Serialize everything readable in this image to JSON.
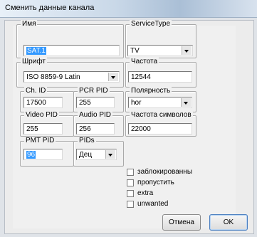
{
  "window": {
    "title": "Сменить данные канала"
  },
  "fields": {
    "name": {
      "label": "Имя",
      "value": "SAT.1"
    },
    "service_type": {
      "label": "ServiceType",
      "value": "TV"
    },
    "font": {
      "label": "Шрифт",
      "value": "ISO 8859-9 Latin"
    },
    "frequency": {
      "label": "Частота",
      "value": "12544"
    },
    "ch_id": {
      "label": "Ch. ID",
      "value": "17500"
    },
    "pcr_pid": {
      "label": "PCR PID",
      "value": "255"
    },
    "polarity": {
      "label": "Полярность",
      "value": "hor"
    },
    "video_pid": {
      "label": "Video PID",
      "value": "255"
    },
    "audio_pid": {
      "label": "Audio PID",
      "value": "256"
    },
    "symbol_rate": {
      "label": "Частота символов",
      "value": "22000"
    },
    "pmt_pid": {
      "label": "PMT PID",
      "value": "96"
    },
    "pids": {
      "label": "PIDs",
      "value": "Дец"
    }
  },
  "checkboxes": [
    {
      "label": "заблокированны",
      "checked": false
    },
    {
      "label": "пропустить",
      "checked": false
    },
    {
      "label": "extra",
      "checked": false
    },
    {
      "label": "unwanted",
      "checked": false
    }
  ],
  "buttons": {
    "cancel": "Отмена",
    "ok": "OK"
  }
}
